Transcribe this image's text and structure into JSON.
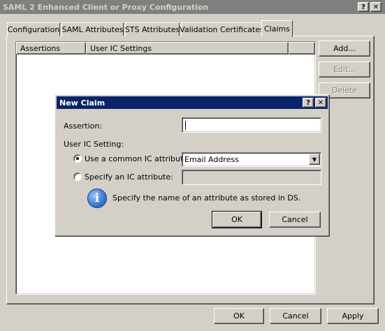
{
  "window": {
    "title": "SAML 2 Enhanced Client or Proxy Configuration",
    "help_glyph": "?",
    "close_glyph": "✕"
  },
  "tabs": [
    {
      "label": "Configuration"
    },
    {
      "label": "SAML Attributes"
    },
    {
      "label": "STS Attributes"
    },
    {
      "label": "Validation Certificates"
    },
    {
      "label": "Claims"
    }
  ],
  "claims_list": {
    "columns": [
      {
        "label": "Assertions"
      },
      {
        "label": "User IC Settings"
      },
      {
        "label": ""
      }
    ]
  },
  "side_buttons": {
    "add": "Add...",
    "edit": "Edit...",
    "delete": "Delete"
  },
  "footer_buttons": {
    "ok": "OK",
    "cancel": "Cancel",
    "apply": "Apply"
  },
  "dialog": {
    "title": "New Claim",
    "assertion_label": "Assertion:",
    "assertion_value": "",
    "user_ic_setting_label": "User IC Setting:",
    "option_common_label": "Use a common IC attribute:",
    "option_common_selected": true,
    "common_attribute_value": "Email Address",
    "option_specify_label": "Specify an IC attribute:",
    "specify_value": "",
    "info_text": "Specify the name of an attribute as stored in DS.",
    "info_icon": "info-icon",
    "ok_label": "OK",
    "cancel_label": "Cancel"
  }
}
